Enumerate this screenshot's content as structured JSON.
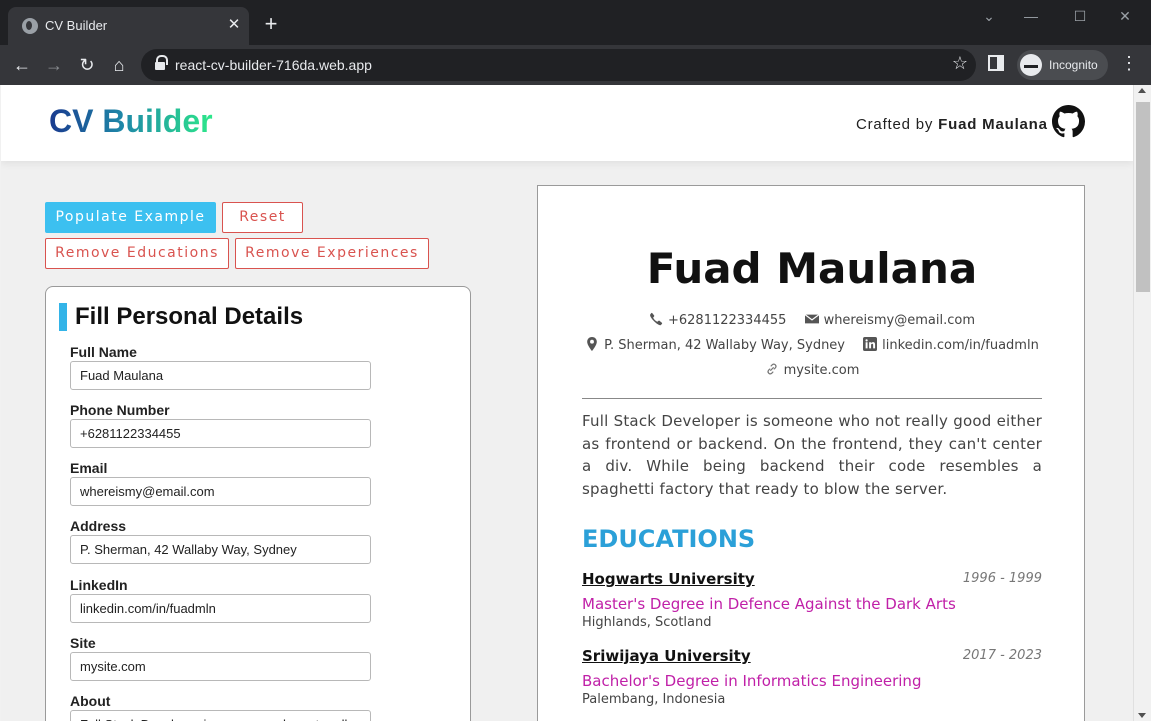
{
  "browser": {
    "tab_title": "CV Builder",
    "url": "react-cv-builder-716da.web.app",
    "incognito_label": "Incognito"
  },
  "header": {
    "logo_part1": "CV",
    "logo_part2": "Builder",
    "crafted_prefix": "Crafted by",
    "crafted_author": "Fuad Maulana"
  },
  "actions": {
    "populate": "Populate Example",
    "reset": "Reset",
    "remove_educations": "Remove Educations",
    "remove_experiences": "Remove Experiences"
  },
  "form": {
    "title": "Fill Personal Details",
    "fields": [
      {
        "label": "Full Name",
        "value": "Fuad Maulana"
      },
      {
        "label": "Phone Number",
        "value": "+6281122334455"
      },
      {
        "label": "Email",
        "value": "whereismy@email.com"
      },
      {
        "label": "Address",
        "value": "P. Sherman, 42 Wallaby Way, Sydney"
      },
      {
        "label": "LinkedIn",
        "value": "linkedin.com/in/fuadmln"
      },
      {
        "label": "Site",
        "value": "mysite.com"
      },
      {
        "label": "About",
        "value": "Full Stack Developer is someone who not really good either"
      }
    ]
  },
  "cv": {
    "name": "Fuad Maulana",
    "phone": "+6281122334455",
    "email": "whereismy@email.com",
    "address": "P. Sherman, 42 Wallaby Way, Sydney",
    "linkedin": "linkedin.com/in/fuadmln",
    "site": "mysite.com",
    "about": "Full Stack Developer is someone who not really good either as frontend or backend. On the frontend, they can't center a div. While being backend their code resembles a spaghetti factory that ready to blow the server.",
    "educations_title": "EDUCATIONS",
    "educations": [
      {
        "school": "Hogwarts University",
        "years": "1996 - 1999",
        "degree": "Master's Degree in Defence Against the Dark Arts",
        "place": "Highlands, Scotland"
      },
      {
        "school": "Sriwijaya University",
        "years": "2017 - 2023",
        "degree": "Bachelor's Degree in Informatics Engineering",
        "place": "Palembang, Indonesia"
      }
    ]
  },
  "icons": {
    "phone": "phone-icon",
    "email": "envelope-icon",
    "address": "map-pin-icon",
    "linkedin": "linkedin-icon",
    "site": "link-icon",
    "github": "github-icon"
  },
  "colors": {
    "accent": "#33b4e8",
    "danger": "#d9534f",
    "degree": "#c020a8"
  }
}
